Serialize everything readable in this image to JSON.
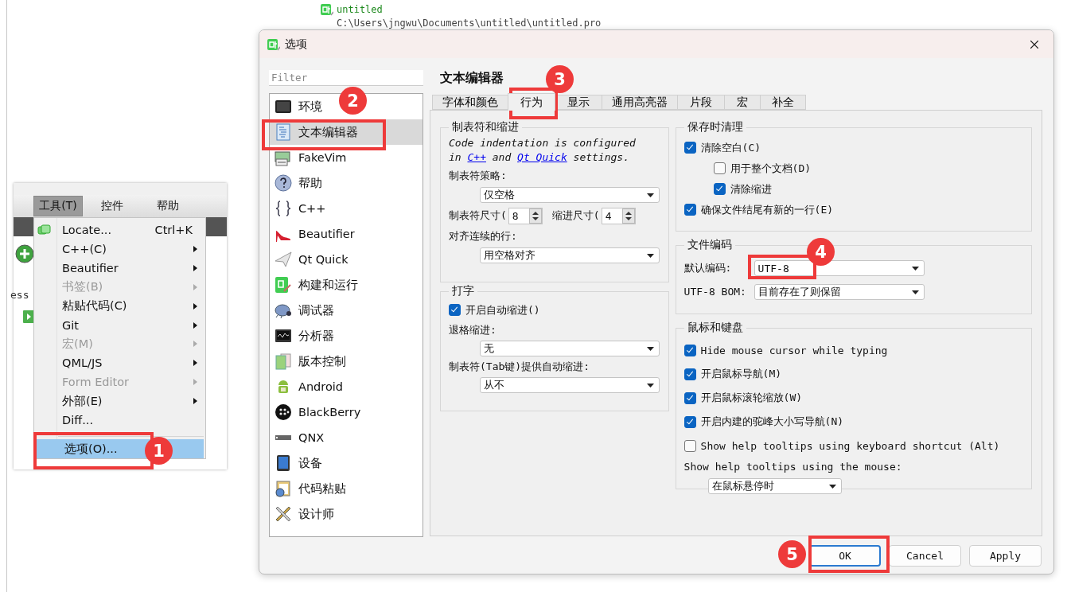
{
  "project": {
    "name": "untitled",
    "path": "C:\\Users\\jngwu\\Documents\\untitled\\untitled.pro"
  },
  "app_window": {
    "menubar": [
      {
        "label": "工具(T)",
        "selected": true
      },
      {
        "label": "控件",
        "selected": false
      },
      {
        "label": "帮助",
        "selected": false
      }
    ],
    "fragment_text": "ess",
    "menu": [
      {
        "kind": "locator",
        "label": "Locate...",
        "shortcut": "Ctrl+K",
        "submenu": false,
        "disabled": false,
        "selected": false
      },
      {
        "kind": "plain",
        "label": "C++(C)",
        "submenu": true,
        "disabled": false,
        "selected": false
      },
      {
        "kind": "plain",
        "label": "Beautifier",
        "submenu": true,
        "disabled": false,
        "selected": false
      },
      {
        "kind": "plain",
        "label": "书签(B)",
        "submenu": true,
        "disabled": true,
        "selected": false
      },
      {
        "kind": "plain",
        "label": "粘贴代码(C)",
        "submenu": true,
        "disabled": false,
        "selected": false
      },
      {
        "kind": "plain",
        "label": "Git",
        "submenu": true,
        "disabled": false,
        "selected": false
      },
      {
        "kind": "plain",
        "label": "宏(M)",
        "submenu": true,
        "disabled": true,
        "selected": false
      },
      {
        "kind": "plain",
        "label": "QML/JS",
        "submenu": true,
        "disabled": false,
        "selected": false
      },
      {
        "kind": "plain",
        "label": "Form Editor",
        "submenu": true,
        "disabled": true,
        "selected": false
      },
      {
        "kind": "plain",
        "label": "外部(E)",
        "submenu": true,
        "disabled": false,
        "selected": false
      },
      {
        "kind": "plain",
        "label": "Diff...",
        "submenu": false,
        "disabled": false,
        "selected": false
      },
      {
        "kind": "separator"
      },
      {
        "kind": "plain",
        "label": "选项(O)...",
        "submenu": false,
        "disabled": false,
        "selected": true
      }
    ]
  },
  "dialog": {
    "title": "选项",
    "filter": {
      "placeholder": "Filter"
    },
    "sidebar": [
      {
        "label": "环境",
        "selected": false
      },
      {
        "label": "文本编辑器",
        "selected": true
      },
      {
        "label": "FakeVim",
        "selected": false
      },
      {
        "label": "帮助",
        "selected": false
      },
      {
        "label": "C++",
        "selected": false
      },
      {
        "label": "Beautifier",
        "selected": false
      },
      {
        "label": "Qt Quick",
        "selected": false
      },
      {
        "label": "构建和运行",
        "selected": false
      },
      {
        "label": "调试器",
        "selected": false
      },
      {
        "label": "分析器",
        "selected": false
      },
      {
        "label": "版本控制",
        "selected": false
      },
      {
        "label": "Android",
        "selected": false
      },
      {
        "label": "BlackBerry",
        "selected": false
      },
      {
        "label": "QNX",
        "selected": false
      },
      {
        "label": "设备",
        "selected": false
      },
      {
        "label": "代码粘贴",
        "selected": false
      },
      {
        "label": "设计师",
        "selected": false
      }
    ],
    "page_title": "文本编辑器",
    "tabs": [
      {
        "label": "字体和颜色",
        "selected": false
      },
      {
        "label": "行为",
        "selected": true
      },
      {
        "label": "显示",
        "selected": false
      },
      {
        "label": "通用高亮器",
        "selected": false
      },
      {
        "label": "片段",
        "selected": false
      },
      {
        "label": "宏",
        "selected": false
      },
      {
        "label": "补全",
        "selected": false
      }
    ],
    "tabs_and_indentation": {
      "title": "制表符和缩进",
      "note": {
        "before": "Code indentation is configured in ",
        "link_1": "C++",
        "middle": " and ",
        "link_2": "Qt Quick",
        "after": " settings."
      },
      "tab_policy": {
        "label": "制表符策略:",
        "value": "仅空格"
      },
      "tab_size": {
        "label": "制表符尺寸(",
        "value": "8"
      },
      "indent_size": {
        "label": "缩进尺寸(",
        "value": "4"
      },
      "align": {
        "label": "对齐连续的行:",
        "value": "用空格对齐"
      }
    },
    "typing": {
      "title": "打字",
      "auto_indent": {
        "label": "开启自动缩进()",
        "checked": true
      },
      "backspace": {
        "label": "退格缩进:",
        "value": "无"
      },
      "tab_key": {
        "label": "制表符(Tab键)提供自动缩进:",
        "value": "从不"
      }
    },
    "cleanup": {
      "title": "保存时清理",
      "options": [
        {
          "label": "清除空白(C)",
          "checked": true,
          "children": [
            {
              "label": "用于整个文档(D)",
              "checked": false
            },
            {
              "label": "清除缩进",
              "checked": true
            }
          ]
        },
        {
          "label": "确保文件结尾有新的一行(E)",
          "checked": true
        }
      ]
    },
    "encoding": {
      "title": "文件编码",
      "default": {
        "label": "默认编码:",
        "value": "UTF-8"
      },
      "bom": {
        "label": "UTF-8 BOM:",
        "value": "目前存在了则保留"
      }
    },
    "mouse": {
      "title": "鼠标和键盘",
      "options": [
        {
          "label": "Hide mouse cursor while typing",
          "checked": true
        },
        {
          "label": "开启鼠标导航(M)",
          "checked": true
        },
        {
          "label": "开启鼠标滚轮缩放(W)",
          "checked": true
        },
        {
          "label": "开启内建的驼峰大小写导航(N)",
          "checked": true
        },
        {
          "label": "Show help tooltips using keyboard shortcut (Alt)",
          "checked": false
        }
      ],
      "tooltips": {
        "label": "Show help tooltips using the mouse:",
        "value": "在鼠标悬停时"
      }
    },
    "buttons": [
      {
        "label": "OK",
        "selected": true
      },
      {
        "label": "Cancel",
        "selected": false
      },
      {
        "label": "Apply",
        "selected": false
      }
    ]
  },
  "annotations": [
    {
      "number": "1"
    },
    {
      "number": "2"
    },
    {
      "number": "3"
    },
    {
      "number": "4"
    },
    {
      "number": "5"
    }
  ]
}
